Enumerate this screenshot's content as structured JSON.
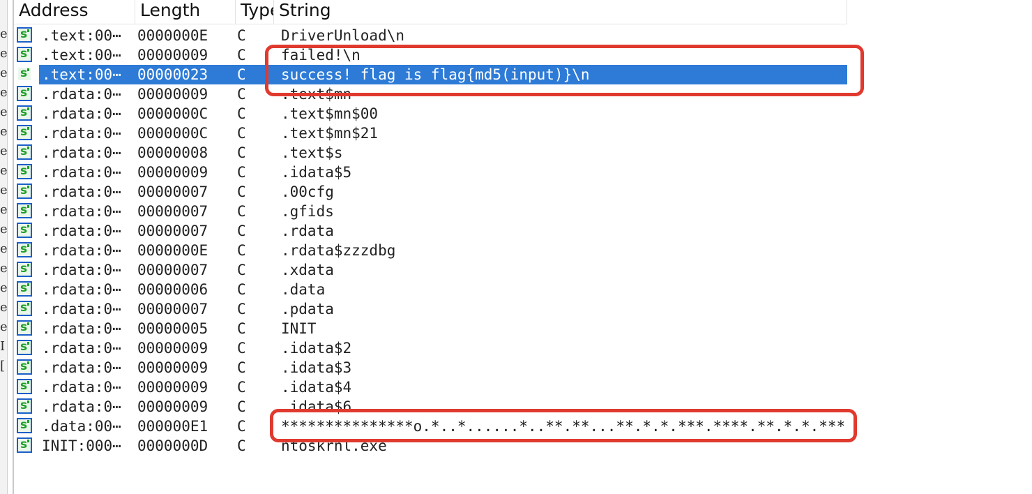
{
  "columns": [
    "Address",
    "Length",
    "Type",
    "String"
  ],
  "left_strip_glyphs": [
    "e",
    "e",
    "e",
    "e",
    "e",
    "e",
    "e",
    "e",
    "e",
    "e",
    "e",
    "e",
    "e",
    "e",
    "e",
    "e",
    "I",
    "["
  ],
  "rows": [
    {
      "address": ".text:00⋯",
      "length": "0000000E",
      "type": "C",
      "string": "DriverUnload\\n"
    },
    {
      "address": ".text:00⋯",
      "length": "00000009",
      "type": "C",
      "string": "failed!\\n"
    },
    {
      "address": ".text:00⋯",
      "length": "00000023",
      "type": "C",
      "string": "success! flag is flag{md5(input)}\\n",
      "selected": true
    },
    {
      "address": ".rdata:0⋯",
      "length": "00000009",
      "type": "C",
      "string": ".text$mn"
    },
    {
      "address": ".rdata:0⋯",
      "length": "0000000C",
      "type": "C",
      "string": ".text$mn$00"
    },
    {
      "address": ".rdata:0⋯",
      "length": "0000000C",
      "type": "C",
      "string": ".text$mn$21"
    },
    {
      "address": ".rdata:0⋯",
      "length": "00000008",
      "type": "C",
      "string": ".text$s"
    },
    {
      "address": ".rdata:0⋯",
      "length": "00000009",
      "type": "C",
      "string": ".idata$5"
    },
    {
      "address": ".rdata:0⋯",
      "length": "00000007",
      "type": "C",
      "string": ".00cfg"
    },
    {
      "address": ".rdata:0⋯",
      "length": "00000007",
      "type": "C",
      "string": ".gfids"
    },
    {
      "address": ".rdata:0⋯",
      "length": "00000007",
      "type": "C",
      "string": ".rdata"
    },
    {
      "address": ".rdata:0⋯",
      "length": "0000000E",
      "type": "C",
      "string": ".rdata$zzzdbg"
    },
    {
      "address": ".rdata:0⋯",
      "length": "00000007",
      "type": "C",
      "string": ".xdata"
    },
    {
      "address": ".rdata:0⋯",
      "length": "00000006",
      "type": "C",
      "string": ".data"
    },
    {
      "address": ".rdata:0⋯",
      "length": "00000007",
      "type": "C",
      "string": ".pdata"
    },
    {
      "address": ".rdata:0⋯",
      "length": "00000005",
      "type": "C",
      "string": "INIT"
    },
    {
      "address": ".rdata:0⋯",
      "length": "00000009",
      "type": "C",
      "string": ".idata$2"
    },
    {
      "address": ".rdata:0⋯",
      "length": "00000009",
      "type": "C",
      "string": ".idata$3"
    },
    {
      "address": ".rdata:0⋯",
      "length": "00000009",
      "type": "C",
      "string": ".idata$4"
    },
    {
      "address": ".rdata:0⋯",
      "length": "00000009",
      "type": "C",
      "string": ".idata$6"
    },
    {
      "address": ".data:00⋯",
      "length": "000000E1",
      "type": "C",
      "string": "***************o.*..*......*..**.**...**.*.*.***.****.**.*.*.***⋯"
    },
    {
      "address": "INIT:000⋯",
      "length": "0000000D",
      "type": "C",
      "string": "ntoskrnl.exe"
    }
  ],
  "icon_name": "string-s-icon",
  "colors": {
    "selection": "#2d7bd6",
    "annotation": "#e03a2f",
    "icon_border": "#1b5fc9",
    "icon_letter": "#1e9e2a"
  }
}
